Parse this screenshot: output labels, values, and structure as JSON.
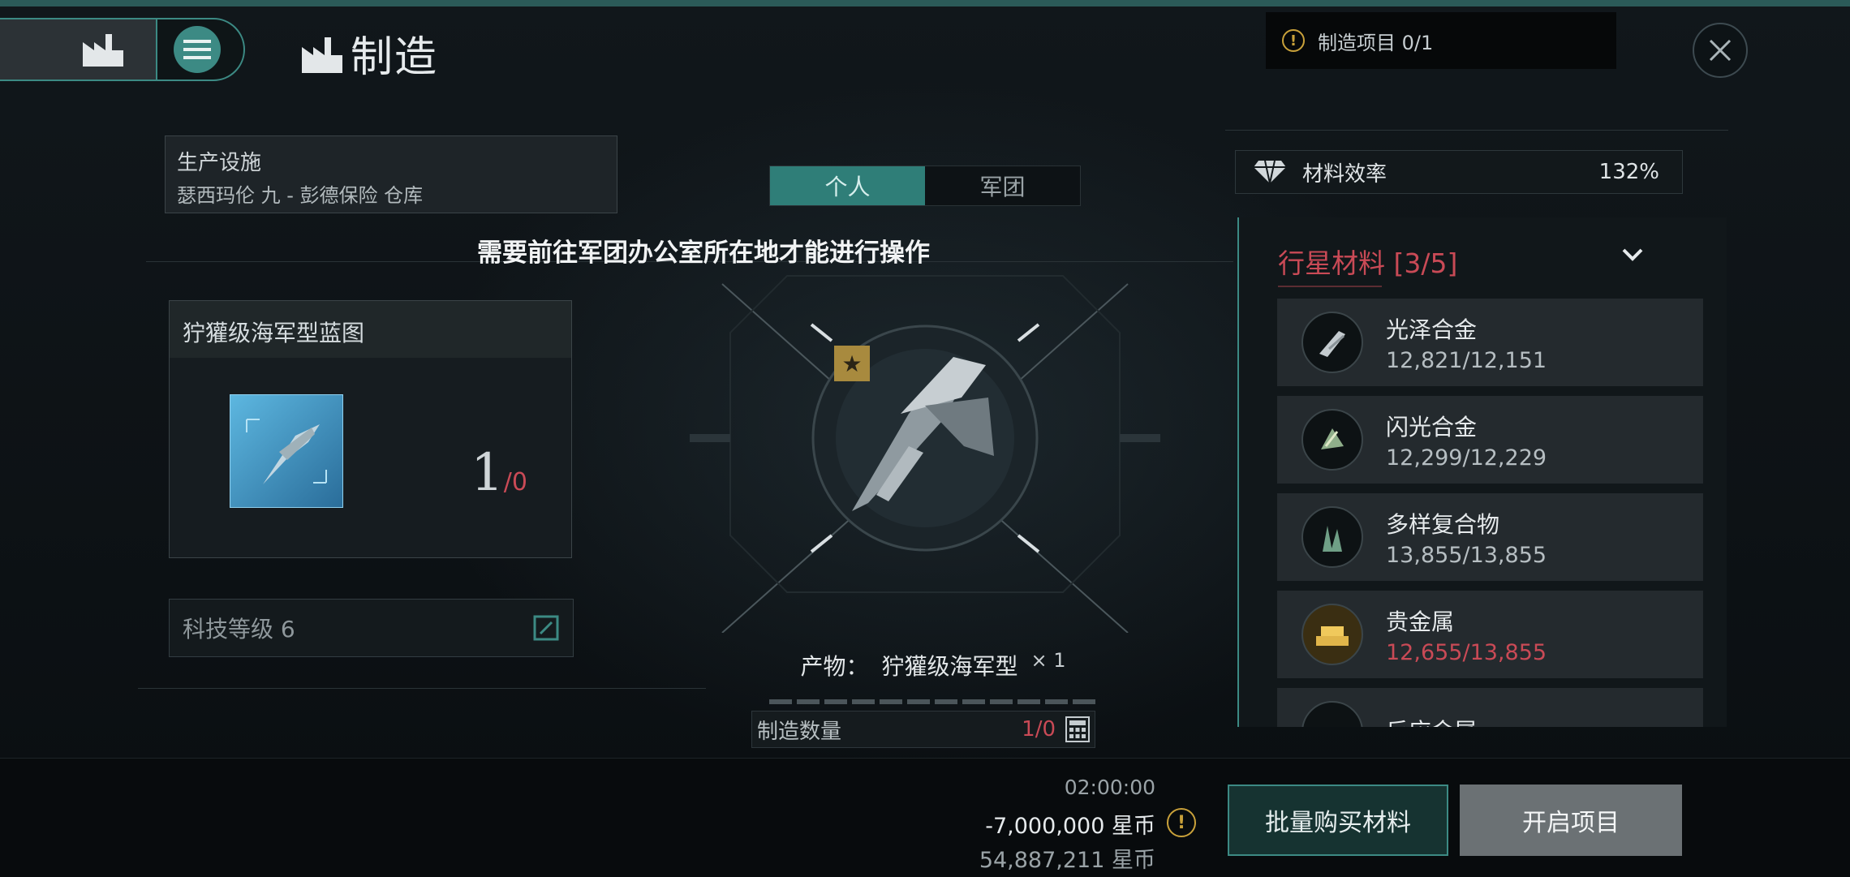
{
  "header": {
    "title": "制造",
    "project_counter": "制造项目 0/1"
  },
  "facility": {
    "label": "生产设施",
    "location": "瑟西玛伦 九 - 彭德保险 仓库"
  },
  "blueprint": {
    "title": "狞獾级海军型蓝图",
    "have": "1",
    "need": "/0"
  },
  "tech": {
    "label": "科技等级 6"
  },
  "tabs": {
    "personal": "个人",
    "corp": "军团"
  },
  "notice": "需要前往军团办公室所在地才能进行操作",
  "product": {
    "label": "产物：",
    "name": "狞獾级海军型",
    "qty": "× 1"
  },
  "manufacture_qty": {
    "label": "制造数量",
    "value": "1/0"
  },
  "efficiency": {
    "label": "材料效率",
    "value": "132%"
  },
  "materials": {
    "title": "行星材料 [3/5]",
    "items": [
      {
        "name": "光泽合金",
        "count": "12,821/12,151",
        "short": false
      },
      {
        "name": "闪光合金",
        "count": "12,299/12,229",
        "short": false
      },
      {
        "name": "多样复合物",
        "count": "13,855/13,855",
        "short": false
      },
      {
        "name": "贵金属",
        "count": "12,655/13,855",
        "short": true
      },
      {
        "name": "反应金属",
        "count": "",
        "short": false
      }
    ]
  },
  "footer": {
    "time": "02:00:00",
    "cost": "-7,000,000 星币",
    "balance": "54,887,211 星币",
    "buy_button": "批量购买材料",
    "start_button": "开启项目"
  },
  "colors": {
    "accent": "#3c8a84",
    "warning": "#c94a56",
    "alert": "#c9a13a"
  }
}
